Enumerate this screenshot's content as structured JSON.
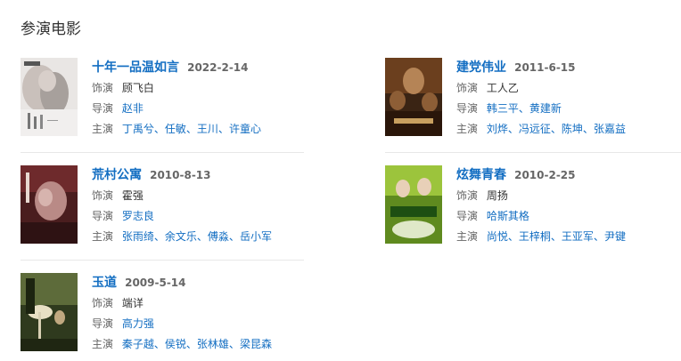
{
  "section_title": "参演电影",
  "movies": [
    {
      "title": "十年一品温如言",
      "date": "2022-2-14",
      "role_label": "饰演",
      "role": "顾飞白",
      "director_label": "导演",
      "directors": [
        "赵非"
      ],
      "cast_label": "主演",
      "cast": [
        "丁禹兮",
        "任敏",
        "王川",
        "许童心"
      ]
    },
    {
      "title": "建党伟业",
      "date": "2011-6-15",
      "role_label": "饰演",
      "role": "工人乙",
      "director_label": "导演",
      "directors": [
        "韩三平",
        "黄建新"
      ],
      "cast_label": "主演",
      "cast": [
        "刘烨",
        "冯远征",
        "陈坤",
        "张嘉益"
      ]
    },
    {
      "title": "荒村公寓",
      "date": "2010-8-13",
      "role_label": "饰演",
      "role": "霍强",
      "director_label": "导演",
      "directors": [
        "罗志良"
      ],
      "cast_label": "主演",
      "cast": [
        "张雨绮",
        "余文乐",
        "傅淼",
        "岳小军"
      ]
    },
    {
      "title": "炫舞青春",
      "date": "2010-2-25",
      "role_label": "饰演",
      "role": "周扬",
      "director_label": "导演",
      "directors": [
        "哈斯其格"
      ],
      "cast_label": "主演",
      "cast": [
        "尚悦",
        "王梓桐",
        "王亚军",
        "尹键"
      ]
    },
    {
      "title": "玉道",
      "date": "2009-5-14",
      "role_label": "饰演",
      "role": "端详",
      "director_label": "导演",
      "directors": [
        "高力强"
      ],
      "cast_label": "主演",
      "cast": [
        "秦子越",
        "侯锐",
        "张林雄",
        "梁昆森"
      ]
    }
  ],
  "colors": {
    "link": "#136ec2",
    "label": "#666666",
    "text": "#333333",
    "divider": "#e8e8e8"
  }
}
